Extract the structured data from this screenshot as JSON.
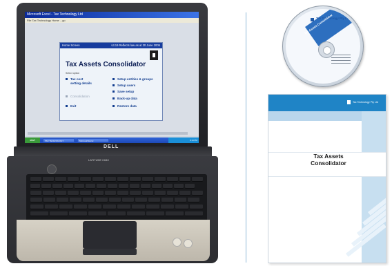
{
  "screen": {
    "window_title": "Microsoft Excel - Tax Technology Ltd",
    "address_bar": "File  Tax Technology Home ...go ",
    "taskbar": {
      "start": "start",
      "items": [
        "TAX TECHNOLOGY",
        "Microsoft Excel"
      ],
      "tray": "3:14 PM"
    }
  },
  "app_panel": {
    "title_left": "Home Screen",
    "title_right": "v3.19 Reflects law as at 30 June 2005",
    "heading": "Tax Assets Consolidator",
    "subheading": "Select option",
    "menu_left": [
      "Tax cost setting details",
      "Consolidation",
      "Exit"
    ],
    "menu_right": [
      "Setup entities & groups",
      "Setup users",
      "Save setup",
      "Back-up data",
      "Restore data"
    ]
  },
  "laptop": {
    "brand": "DELL",
    "model": "LATITUDE C640"
  },
  "cd": {
    "company": "Tax Technology Pty Ltd",
    "product": "Tax Assets Consolidator"
  },
  "manual": {
    "company": "Tax Technology Pty Ltd",
    "title": "Tax Assets Consolidator"
  },
  "colors": {
    "manual_blue": "#1f84c6",
    "manual_light": "#c7dff0",
    "panel_navy": "#173c9e",
    "divider": "#8fb8d8"
  }
}
